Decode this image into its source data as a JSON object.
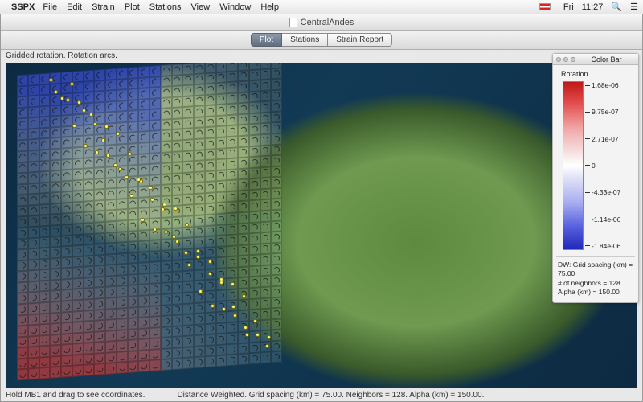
{
  "menubar": {
    "app": "SSPX",
    "items": [
      "File",
      "Edit",
      "Strain",
      "Plot",
      "Stations",
      "View",
      "Window",
      "Help"
    ],
    "clock_day": "Fri",
    "clock_time": "11:27"
  },
  "window": {
    "title": "CentralAndes"
  },
  "toolbar": {
    "tabs": [
      "Plot",
      "Stations",
      "Strain Report"
    ],
    "active_index": 0
  },
  "plot": {
    "caption": "Gridded rotation. Rotation arcs.",
    "status_hint": "Hold MB1 and drag to see coordinates.",
    "status_params": "Distance Weighted. Grid spacing (km) = 75.00. Neighbors = 128. Alpha (km) = 150.00."
  },
  "colorbar": {
    "panel_title": "Color Bar",
    "label": "Rotation",
    "ticks": [
      "1.68e-06",
      "9.75e-07",
      "2.71e-07",
      "0",
      "-4.33e-07",
      "-1.14e-06",
      "-1.84e-06"
    ],
    "meta_lines": [
      "DW: Grid spacing (km) = 75.00",
      "# of neighbors = 128",
      "Alpha (km) = 150.00"
    ]
  },
  "chart_data": {
    "type": "heatmap",
    "title": "Gridded rotation. Rotation arcs.",
    "value_label": "Rotation",
    "color_scale": {
      "min": -1.84e-06,
      "max": 1.68e-06,
      "midpoint": 0,
      "ticks": [
        1.68e-06,
        9.75e-07,
        2.71e-07,
        0,
        -4.33e-07,
        -1.14e-06,
        -1.84e-06
      ],
      "colormap": "blue-white-red (diverging)"
    },
    "grid": {
      "cols": 24,
      "rows": 28,
      "spacing_km": 75.0
    },
    "parameters": {
      "method": "Distance Weighted",
      "neighbors": 128,
      "alpha_km": 150.0
    },
    "region": "Central Andes (satellite basemap)",
    "overlays": [
      "rotation arcs per cell",
      "GPS station markers"
    ]
  }
}
